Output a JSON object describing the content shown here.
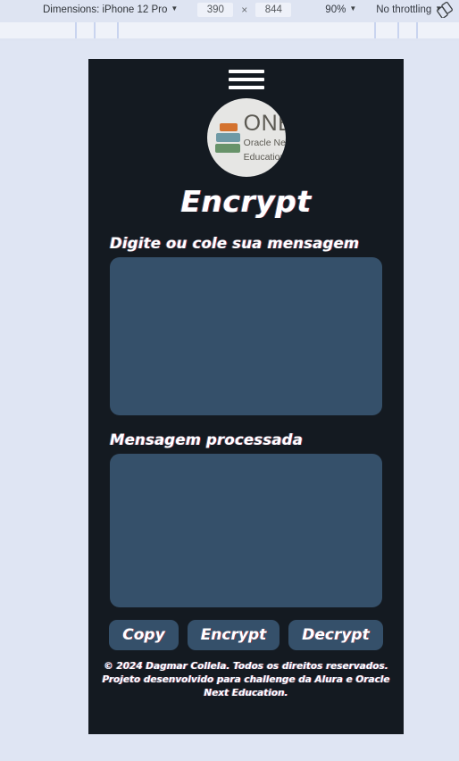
{
  "devtools": {
    "dimensions_label": "Dimensions: iPhone 12 Pro",
    "width": "390",
    "times_symbol": "×",
    "height": "844",
    "zoom": "90%",
    "throttling": "No throttling",
    "caret": "▼",
    "rotate_icon_name": "rotate-device-icon"
  },
  "app": {
    "menu_icon": "hamburger-menu-icon",
    "logo": {
      "wordmark": "ONE",
      "subtitle_line1": "Oracle Next",
      "subtitle_line2": "Education"
    },
    "title": "Encrypt",
    "input": {
      "label": "Digite ou cole sua mensagem",
      "value": "",
      "placeholder": ""
    },
    "output": {
      "label": "Mensagem processada",
      "value": "",
      "placeholder": ""
    },
    "buttons": [
      {
        "label": "Copy",
        "name": "copy-button"
      },
      {
        "label": "Encrypt",
        "name": "encrypt-button"
      },
      {
        "label": "Decrypt",
        "name": "decrypt-button"
      }
    ],
    "footer": {
      "line1": "© 2024 Dagmar Collela. Todos os direitos reservados.",
      "line2": "Projeto desenvolvido para challenge da Alura e Oracle Next Education."
    }
  },
  "colors": {
    "app_background": "#141a21",
    "field_background": "#35506a",
    "button_background": "#35506a",
    "devtools_background": "#dee4f2",
    "page_background": "#dfe5f3",
    "logo_badge": "#e6e6e4"
  }
}
